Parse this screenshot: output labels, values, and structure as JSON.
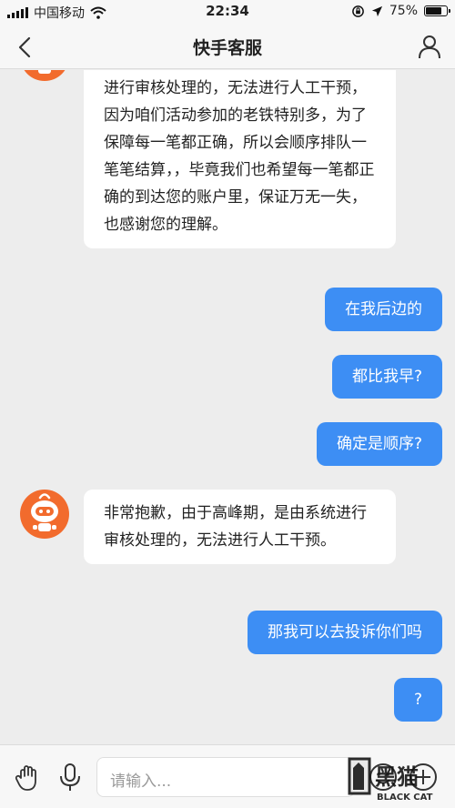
{
  "status_bar": {
    "carrier": "中国移动",
    "time": "22:34",
    "battery": "75%",
    "battery_level": 0.75
  },
  "header": {
    "title": "快手客服"
  },
  "messages": [
    {
      "from": "agent",
      "text": "进行审核处理的，无法进行人工干预，因为咱们活动参加的老铁特别多，为了保障每一笔都正确，所以会顺序排队一笔笔结算，，毕竟我们也希望每一笔都正确的到达您的账户里，保证万无一失，也感谢您的理解。"
    },
    {
      "from": "user",
      "text": "在我后边的"
    },
    {
      "from": "user",
      "text": "都比我早?"
    },
    {
      "from": "user",
      "text": "确定是顺序?"
    },
    {
      "from": "agent",
      "text": "非常抱歉，由于高峰期，是由系统进行审核处理的，无法进行人工干预。"
    },
    {
      "from": "user",
      "text": "那我可以去投诉你们吗"
    },
    {
      "from": "user",
      "text": "?"
    }
  ],
  "input": {
    "placeholder": "请输入..."
  },
  "icons": {
    "back": "chevron-left-icon",
    "profile": "user-icon",
    "gesture": "hand-icon",
    "voice": "microphone-icon",
    "emoji": "emoji-icon",
    "more": "plus-icon"
  },
  "colors": {
    "user_bubble": "#3d8ef4",
    "agent_bubble": "#ffffff",
    "bot_avatar": "#f26b2d",
    "background": "#ededed"
  },
  "watermark": {
    "text_cn": "黑猫",
    "text_en": "BLACK CAT"
  }
}
